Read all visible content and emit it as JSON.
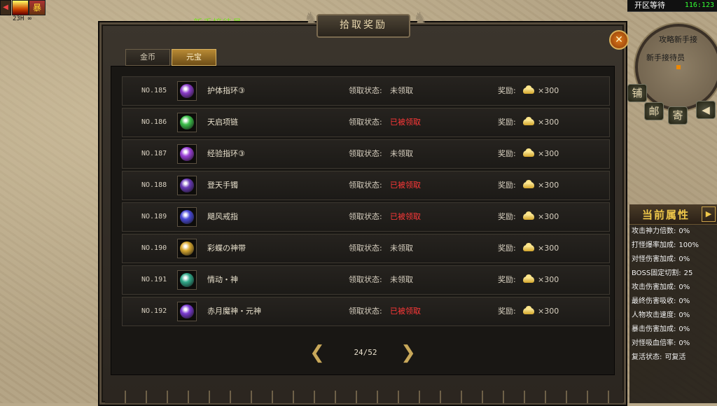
{
  "hud": {
    "timer": "23H ∞",
    "buff_glyph": "暴",
    "npc_name": "新手接待员",
    "server_status": "开区等待",
    "coords": "116:123",
    "minimap_label_1": "攻略新手接",
    "minimap_label_2": "新手接待员",
    "side_buttons": [
      "铺",
      "邮",
      "寄"
    ]
  },
  "dialog": {
    "title": "拾取奖励",
    "tabs": [
      "金币",
      "元宝"
    ],
    "active_tab": 1,
    "status_label": "领取状态:",
    "reward_label": "奖励:",
    "rows": [
      {
        "no": "NO.185",
        "name": "护体指环③",
        "status": "未领取",
        "claimed": false,
        "qty": "×300",
        "icon": "purple-orb-icon",
        "color": "#8a3cc8"
      },
      {
        "no": "NO.186",
        "name": "天启项链",
        "status": "已被领取",
        "claimed": true,
        "qty": "×300",
        "icon": "green-necklace-icon",
        "color": "#3cbf4a"
      },
      {
        "no": "NO.187",
        "name": "经验指环③",
        "status": "未领取",
        "claimed": false,
        "qty": "×300",
        "icon": "purple-ring-icon",
        "color": "#9b40d8"
      },
      {
        "no": "NO.188",
        "name": "登天手镯",
        "status": "已被领取",
        "claimed": true,
        "qty": "×300",
        "icon": "bracelet-icon",
        "color": "#6a3ab8"
      },
      {
        "no": "NO.189",
        "name": "飓风戒指",
        "status": "已被领取",
        "claimed": true,
        "qty": "×300",
        "icon": "storm-ring-icon",
        "color": "#4a4ad8"
      },
      {
        "no": "NO.190",
        "name": "彩蝶の神带",
        "status": "未领取",
        "claimed": false,
        "qty": "×300",
        "icon": "butterfly-belt-icon",
        "color": "#d8a830"
      },
      {
        "no": "NO.191",
        "name": "情动・神",
        "status": "未领取",
        "claimed": false,
        "qty": "×300",
        "icon": "emotion-orb-icon",
        "color": "#30a888"
      },
      {
        "no": "NO.192",
        "name": "赤月魔神・元神",
        "status": "已被领取",
        "claimed": true,
        "qty": "×300",
        "icon": "demon-soul-icon",
        "color": "#7a3ad0"
      }
    ],
    "page": "24/52"
  },
  "attributes": {
    "title": "当前属性",
    "rows": [
      {
        "k": "攻击神力倍数:",
        "v": "0%"
      },
      {
        "k": "打怪爆率加成:",
        "v": "100%"
      },
      {
        "k": "对怪伤害加成:",
        "v": "0%"
      },
      {
        "k": "BOSS固定切割:",
        "v": "25"
      },
      {
        "k": "攻击伤害加成:",
        "v": "0%"
      },
      {
        "k": "最终伤害吸收:",
        "v": "0%"
      },
      {
        "k": "人物攻击速度:",
        "v": "0%"
      },
      {
        "k": "暴击伤害加成:",
        "v": "0%"
      },
      {
        "k": "对怪吸血倍率:",
        "v": "0%"
      },
      {
        "k": "复活状态:",
        "v": "可复活"
      }
    ]
  },
  "colors": {
    "unclaimed": "#d8d0c0",
    "claimed": "#ff3838",
    "accent": "#f0c84a"
  }
}
